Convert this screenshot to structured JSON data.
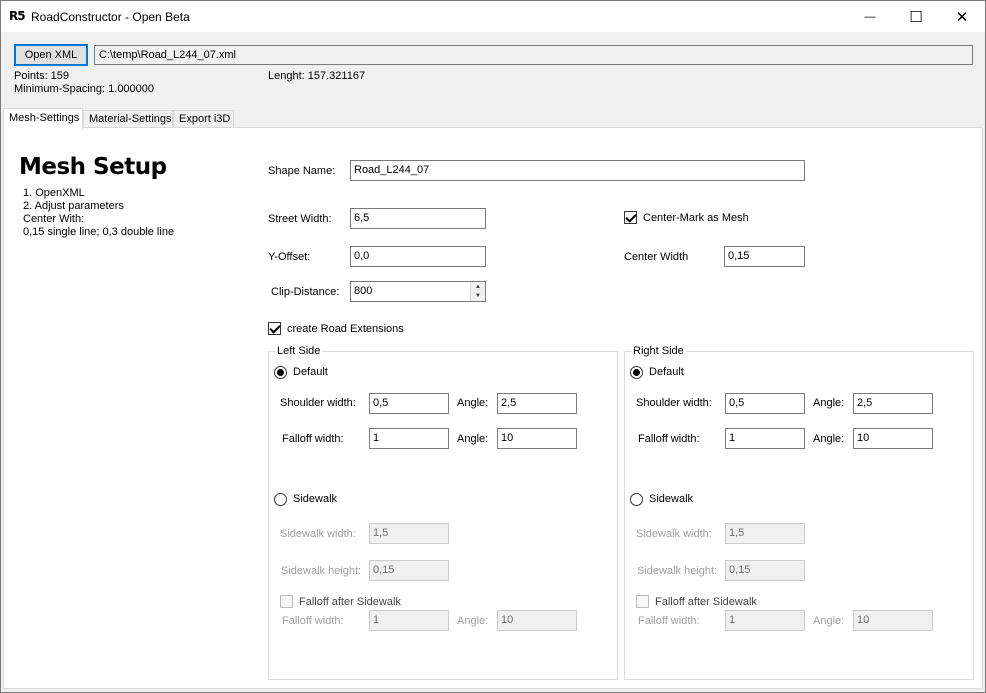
{
  "window": {
    "logo": "R5",
    "title": "RoadConstructor - Open Beta",
    "minimize_glyph": "—",
    "maximize_glyph": "☐",
    "close_glyph": "✕"
  },
  "toolbar": {
    "open_xml_label": "Open XML",
    "file_path": "C:\\temp\\Road_L244_07.xml"
  },
  "stats": {
    "points": "Points: 159",
    "min_spacing": "Minimum-Spacing: 1.000000",
    "length": "Lenght: 157.321167"
  },
  "tabs": [
    {
      "label": "Mesh-Settings"
    },
    {
      "label": "Material-Settings"
    },
    {
      "label": "Export i3D"
    }
  ],
  "mesh": {
    "heading": "Mesh Setup",
    "instructions": [
      "1. OpenXML",
      "2. Adjust parameters",
      "Center With:",
      "0,15 single line; 0,3 double line"
    ],
    "shape_name_label": "Shape Name:",
    "shape_name_value": "Road_L244_07",
    "street_width_label": "Street Width:",
    "street_width_value": "6,5",
    "y_offset_label": "Y-Offset:",
    "y_offset_value": "0,0",
    "clip_distance_label": "Clip-Distance:",
    "clip_distance_value": "800",
    "center_mark_label": "Center-Mark as Mesh",
    "center_width_label": "Center Width",
    "center_width_value": "0,15",
    "road_ext_label": "create Road Extensions"
  },
  "left_side": {
    "title": "Left Side",
    "default_label": "Default",
    "shoulder_width_label": "Shoulder width:",
    "shoulder_width_value": "0,5",
    "shoulder_angle_label": "Angle:",
    "shoulder_angle_value": "2,5",
    "falloff_width_label": "Falloff width:",
    "falloff_width_value": "1",
    "falloff_angle_label": "Angle:",
    "falloff_angle_value": "10",
    "sidewalk_label": "Sidewalk",
    "sidewalk_width_label": "Sidewalk width:",
    "sidewalk_width_value": "1,5",
    "sidewalk_height_label": "Sidewalk height:",
    "sidewalk_height_value": "0,15",
    "falloff_after_label": "Falloff after Sidewalk",
    "sw_falloff_width_label": "Falloff width:",
    "sw_falloff_width_value": "1",
    "sw_falloff_angle_label": "Angle:",
    "sw_falloff_angle_value": "10"
  },
  "right_side": {
    "title": "Right Side",
    "default_label": "Default",
    "shoulder_width_label": "Shoulder width:",
    "shoulder_width_value": "0,5",
    "shoulder_angle_label": "Angle:",
    "shoulder_angle_value": "2,5",
    "falloff_width_label": "Falloff width:",
    "falloff_width_value": "1",
    "falloff_angle_label": "Angle:",
    "falloff_angle_value": "10",
    "sidewalk_label": "Sidewalk",
    "sidewalk_width_label": "Sidewalk width:",
    "sidewalk_width_value": "1,5",
    "sidewalk_height_label": "Sidewalk height:",
    "sidewalk_height_value": "0,15",
    "falloff_after_label": "Falloff after Sidewalk",
    "sw_falloff_width_label": "Falloff width:",
    "sw_falloff_width_value": "1",
    "sw_falloff_angle_label": "Angle:",
    "sw_falloff_angle_value": "10"
  }
}
